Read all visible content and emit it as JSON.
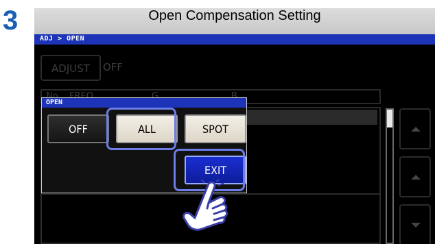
{
  "step": {
    "number": "3"
  },
  "title": {
    "text": "Open Compensation Setting"
  },
  "breadcrumb": {
    "text": "ADJ > OPEN"
  },
  "adjust": {
    "button_label": "ADJUST",
    "value": "OFF"
  },
  "table": {
    "columns": [
      "No.",
      "FREQ",
      "G",
      "B"
    ]
  },
  "popup": {
    "title": "OPEN",
    "options": {
      "off": "OFF",
      "all": "ALL",
      "spot": "SPOT"
    },
    "exit_label": "EXIT"
  },
  "icons": {
    "scroll_up": "triangle-up-icon",
    "scroll_down": "triangle-down-icon",
    "pointer": "tap-hand-icon"
  },
  "colors": {
    "accent": "#1d34b8",
    "step_number": "#1a5fb4",
    "highlight": "#6c7de6",
    "exit_button": "#1a2fd1"
  }
}
